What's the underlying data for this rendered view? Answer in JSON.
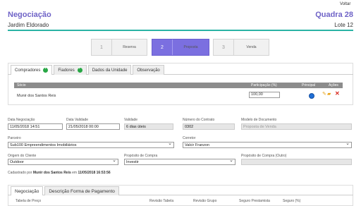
{
  "header": {
    "voltar": "Voltar",
    "title": "Negociação",
    "subtitle": "Jardim Eldorado",
    "quadra": "Quadra 28",
    "lote": "Lote 12"
  },
  "steps": [
    {
      "num": "1",
      "label": "Reserva",
      "active": false
    },
    {
      "num": "2",
      "label": "Proposta",
      "active": true
    },
    {
      "num": "3",
      "label": "Venda",
      "active": false
    }
  ],
  "tabs": [
    "Compradores",
    "Fiadores",
    "Dados da Unidade",
    "Observação"
  ],
  "table": {
    "headers": {
      "socio": "Sócio",
      "participacao": "Participação (%)",
      "principal": "Principal",
      "acoes": "Ações"
    },
    "rows": [
      {
        "socio": "Munir dos Santos Reis",
        "participacao": "100,00"
      }
    ]
  },
  "form": {
    "data_negociacao": {
      "label": "Data Negociação",
      "value": "11/05/2018 14:51"
    },
    "data_validade": {
      "label": "Data Validade",
      "value": "21/05/2018 00:00"
    },
    "validade": {
      "label": "Validade",
      "value": "6 dias úteis"
    },
    "numero_contrato": {
      "label": "Número do Contrato",
      "value": "0302"
    },
    "modelo_documento": {
      "label": "Modelo de Documento",
      "placeholder": "Proposta de Venda"
    },
    "parceiro": {
      "label": "Parceiro",
      "value": "Sub100 Empreendimentos Imobiliários"
    },
    "corretor": {
      "label": "Corretor",
      "value": "Valcir Franzon"
    },
    "origem_cliente": {
      "label": "Origem do Cliente",
      "value": "Outdoor"
    },
    "proposito_compra": {
      "label": "Propósito de Compra",
      "value": "Investir"
    },
    "proposito_outro": {
      "label": "Propósito de Compra (Outro)",
      "value": ""
    }
  },
  "cadastro": {
    "prefix": "Cadastrado por",
    "user": "Munir dos Santos Reis",
    "middle": "em",
    "datetime": "11/05/2018 16:53:56"
  },
  "bottom_tabs": [
    "Negociação",
    "Descrição Forma de Pagamento"
  ],
  "bottom_columns": [
    "Tabela de Preço",
    "Revisão Tabela",
    "Revisão Grupo",
    "Seguro Prestamista",
    "Seguro (%)"
  ],
  "colors": {
    "accent": "#6f63c7",
    "step_active": "#7b6fe0",
    "teal_line": "#2bb3a5",
    "add_green": "#28a745",
    "delete_red": "#d9261c"
  }
}
